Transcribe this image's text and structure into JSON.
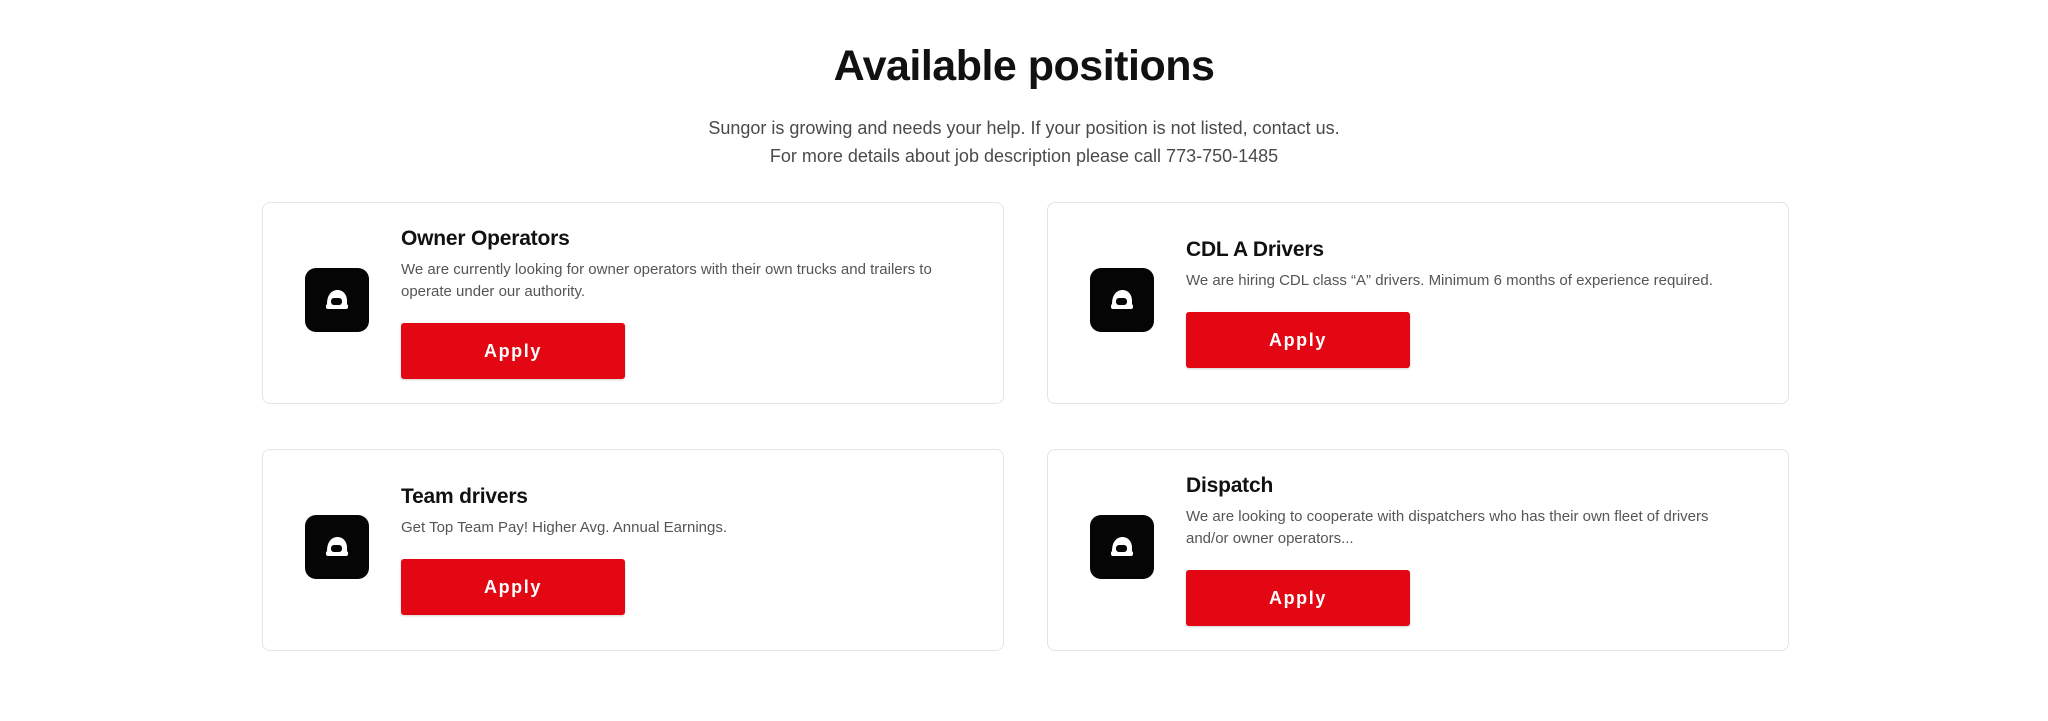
{
  "section": {
    "title": "Available positions",
    "subtitle_line1": "Sungor is growing and needs your help. If your position is not listed, contact us.",
    "subtitle_line2": "For more details about job description please call 773-750-1485"
  },
  "positions": [
    {
      "title": "Owner Operators",
      "description": "We are currently looking for owner operators with their own trucks and trailers to operate under our authority.",
      "button_label": "Apply",
      "icon": "driver-helmet-icon"
    },
    {
      "title": "CDL A Drivers",
      "description": "We are hiring CDL class “A” drivers. Minimum 6 months of experience required.",
      "button_label": "Apply",
      "icon": "driver-helmet-icon"
    },
    {
      "title": "Team drivers",
      "description": "Get Top Team Pay! Higher Avg. Annual Earnings.",
      "button_label": "Apply",
      "icon": "driver-helmet-icon"
    },
    {
      "title": "Dispatch",
      "description": "We are looking to cooperate with dispatchers who has their own fleet of drivers and/or owner operators...",
      "button_label": "Apply",
      "icon": "driver-helmet-icon"
    }
  ],
  "colors": {
    "accent": "#e30613",
    "icon_background": "#050505",
    "card_border": "#e4e4e4"
  }
}
